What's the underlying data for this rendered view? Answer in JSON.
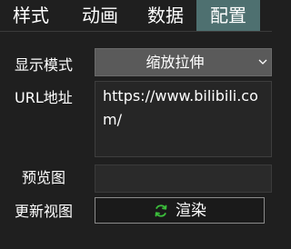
{
  "tabs": [
    {
      "label": "样式",
      "active": false
    },
    {
      "label": "动画",
      "active": false
    },
    {
      "label": "数据",
      "active": false
    },
    {
      "label": "配置",
      "active": true
    }
  ],
  "colors": {
    "active_tab": "#4e7070",
    "refresh_icon": "#3bbf3b",
    "background": "#1f1f1f"
  },
  "form": {
    "display_mode": {
      "label": "显示模式",
      "value": "缩放拉伸"
    },
    "url": {
      "label": "URL地址",
      "value_lines": [
        "https://www.bilibili.co",
        "m/"
      ]
    },
    "preview": {
      "label": "预览图"
    },
    "update_view": {
      "label": "更新视图",
      "button_label": "渲染",
      "button_icon": "refresh-icon"
    }
  }
}
